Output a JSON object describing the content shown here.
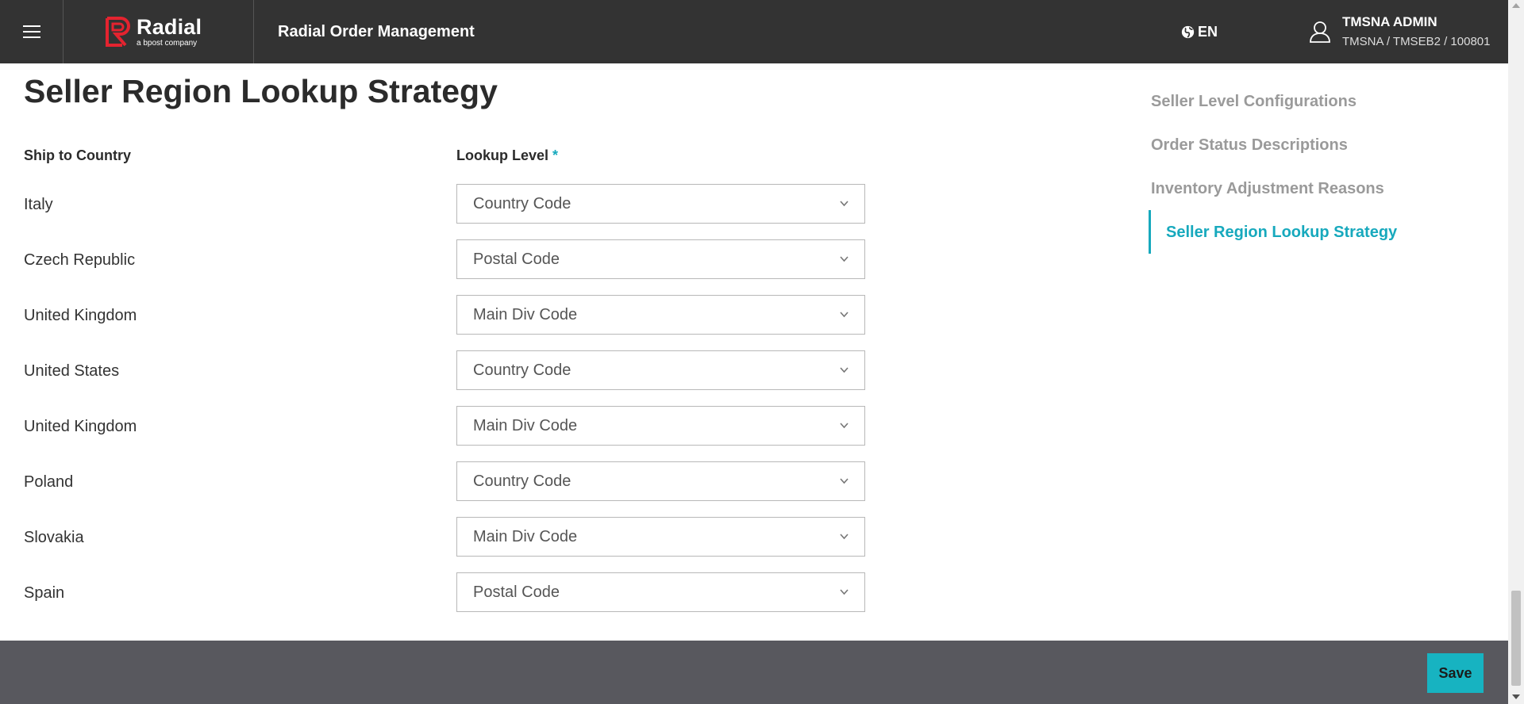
{
  "header": {
    "brand_name": "Radial",
    "brand_sub": "a bpost company",
    "app_title": "Radial Order Management",
    "language": "EN",
    "user_name": "TMSNA ADMIN",
    "user_context": "TMSNA / TMSEB2 / 100801"
  },
  "colors": {
    "accent": "#17a9bd",
    "header_bg": "#333333",
    "footer_bg": "#58585e",
    "logo_red": "#e4232f"
  },
  "page": {
    "title": "Seller Region Lookup Strategy",
    "col_country": "Ship to Country",
    "col_lookup": "Lookup Level",
    "required_mark": "*",
    "rows": [
      {
        "country": "Italy",
        "lookup": "Country Code"
      },
      {
        "country": "Czech Republic",
        "lookup": "Postal Code"
      },
      {
        "country": "United Kingdom",
        "lookup": "Main Div Code"
      },
      {
        "country": "United States",
        "lookup": "Country Code"
      },
      {
        "country": "United Kingdom",
        "lookup": "Main Div Code"
      },
      {
        "country": "Poland",
        "lookup": "Country Code"
      },
      {
        "country": "Slovakia",
        "lookup": "Main Div Code"
      },
      {
        "country": "Spain",
        "lookup": "Postal Code"
      }
    ]
  },
  "right_nav": {
    "items": [
      {
        "label": "Seller Level Configurations"
      },
      {
        "label": "Order Status Descriptions"
      },
      {
        "label": "Inventory Adjustment Reasons"
      },
      {
        "label": "Seller Region Lookup Strategy"
      }
    ],
    "active_index": 3
  },
  "footer": {
    "save_label": "Save"
  },
  "icons": [
    "hamburger-icon",
    "radial-logo-icon",
    "globe-icon",
    "user-icon",
    "chevron-down-icon"
  ]
}
